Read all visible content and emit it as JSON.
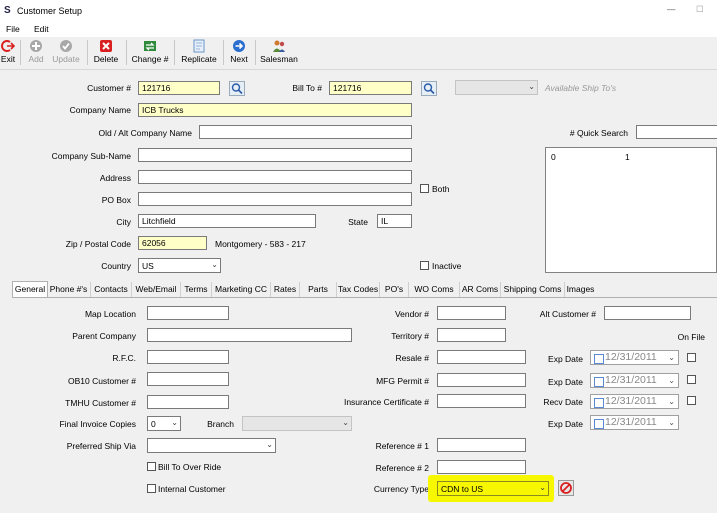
{
  "window": {
    "title": "Customer Setup",
    "minimize": "—",
    "maximize": "☐"
  },
  "menu": [
    "File",
    "Edit"
  ],
  "toolbar": {
    "exit": "Exit",
    "add": "Add",
    "update": "Update",
    "delete": "Delete",
    "change": "Change #",
    "replicate": "Replicate",
    "next": "Next",
    "salesman": "Salesman"
  },
  "header": {
    "customer_no_label": "Customer #",
    "customer_no": "121716",
    "bill_to_label": "Bill To #",
    "bill_to": "121716",
    "available_ship_tos": "Available Ship To's",
    "company_name_label": "Company Name",
    "company_name": "ICB Trucks",
    "old_alt_label": "Old / Alt Company Name",
    "old_alt": "",
    "quick_search_label": "# Quick Search",
    "quick_search": "",
    "sub_name_label": "Company Sub-Name",
    "sub_name": "",
    "address_label": "Address",
    "address": "",
    "po_box_label": "PO Box",
    "po_box": "",
    "both_label": "Both",
    "city_label": "City",
    "city": "Litchfield",
    "state_label": "State",
    "state": "IL",
    "zip_label": "Zip / Postal Code",
    "zip": "62056",
    "zip_info": "Montgomery - 583 - 217",
    "country_label": "Country",
    "country": "US",
    "inactive_label": "Inactive",
    "list_col1": "0",
    "list_col2": "1"
  },
  "tabs": [
    "General",
    "Phone #'s",
    "Contacts",
    "Web/Email",
    "Terms",
    "Marketing CC",
    "Rates",
    "Parts",
    "Tax Codes",
    "PO's",
    "WO Coms",
    "AR Coms",
    "Shipping Coms",
    "Images"
  ],
  "general": {
    "map_location_label": "Map Location",
    "map_location": "",
    "parent_company_label": "Parent Company",
    "parent_company": "",
    "rfc_label": "R.F.C.",
    "rfc": "",
    "ob10_label": "OB10 Customer #",
    "ob10": "",
    "tmhu_label": "TMHU Customer #",
    "tmhu": "",
    "final_invoice_label": "Final Invoice Copies",
    "final_invoice": "0",
    "branch_label": "Branch",
    "branch": "",
    "preferred_ship_via_label": "Preferred Ship Via",
    "preferred_ship_via": "",
    "bill_to_override_label": "Bill To Over Ride",
    "internal_customer_label": "Internal Customer",
    "vendor_label": "Vendor #",
    "vendor": "",
    "territory_label": "Territory #",
    "territory": "",
    "resale_label": "Resale #",
    "resale": "",
    "mfg_permit_label": "MFG Permit #",
    "mfg_permit": "",
    "insurance_label": "Insurance Certificate #",
    "insurance": "",
    "reference1_label": "Reference # 1",
    "reference1": "",
    "reference2_label": "Reference # 2",
    "reference2": "",
    "currency_type_label": "Currency Type",
    "currency_type": "CDN to US",
    "alt_customer_label": "Alt Customer #",
    "alt_customer": "",
    "on_file_label": "On File",
    "exp_date_label": "Exp Date",
    "recv_date_label": "Recv Date",
    "date_value": "12/31/2011"
  },
  "colors": {
    "highlight": "#f7f700",
    "field_yellow": "#ffffc8",
    "accent_red": "#d82020"
  }
}
